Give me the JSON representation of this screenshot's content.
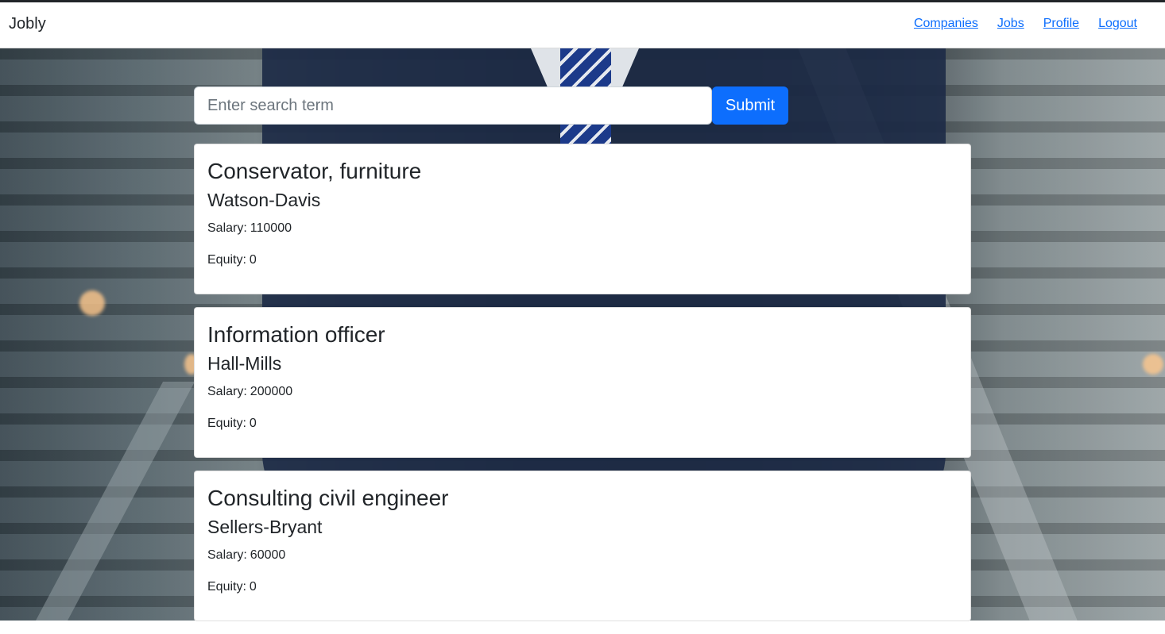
{
  "navbar": {
    "brand": "Jobly",
    "links": [
      "Companies",
      "Jobs",
      "Profile",
      "Logout"
    ]
  },
  "search": {
    "placeholder": "Enter search term",
    "value": "",
    "submit_label": "Submit"
  },
  "labels": {
    "salary": "Salary:",
    "equity": "Equity:"
  },
  "jobs": [
    {
      "title": "Conservator, furniture",
      "company": "Watson-Davis",
      "salary": "110000",
      "equity": "0"
    },
    {
      "title": "Information officer",
      "company": "Hall-Mills",
      "salary": "200000",
      "equity": "0"
    },
    {
      "title": "Consulting civil engineer",
      "company": "Sellers-Bryant",
      "salary": "60000",
      "equity": "0"
    }
  ]
}
